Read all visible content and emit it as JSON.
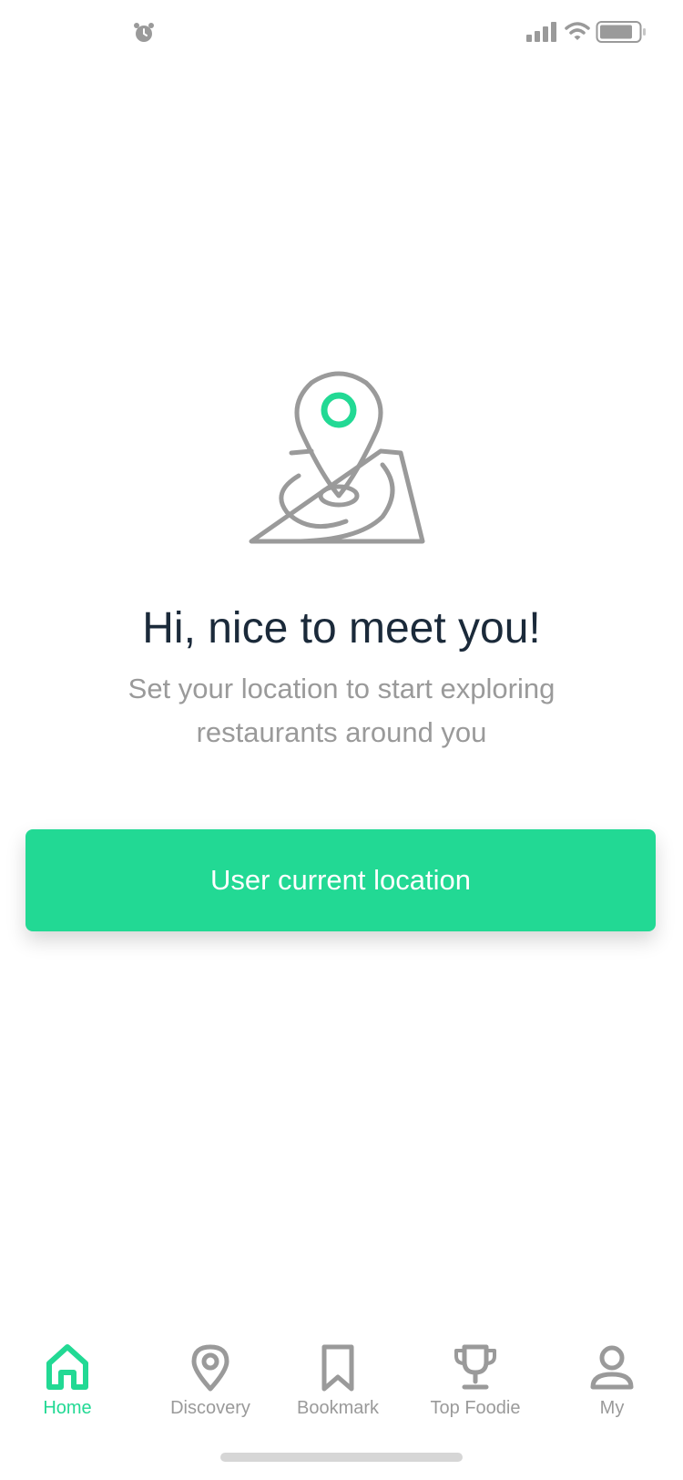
{
  "colors": {
    "accent": "#22d994",
    "icon_gray": "#9a9a9a",
    "headline": "#1b2a3a"
  },
  "status_bar": {
    "icons": [
      "alarm-icon",
      "signal-icon",
      "wifi-icon",
      "battery-icon"
    ]
  },
  "illustration": {
    "icon": "map-pin-icon"
  },
  "onboarding": {
    "headline": "Hi, nice to meet you!",
    "subtitle": "Set your location to start exploring restaurants around you",
    "cta_label": "User current location"
  },
  "tabbar": {
    "active": "Home",
    "tabs": [
      {
        "label": "Home",
        "icon": "home-icon"
      },
      {
        "label": "Discovery",
        "icon": "location-pin-icon"
      },
      {
        "label": "Bookmark",
        "icon": "bookmark-icon"
      },
      {
        "label": "Top Foodie",
        "icon": "trophy-icon"
      },
      {
        "label": "My",
        "icon": "user-icon"
      }
    ]
  }
}
